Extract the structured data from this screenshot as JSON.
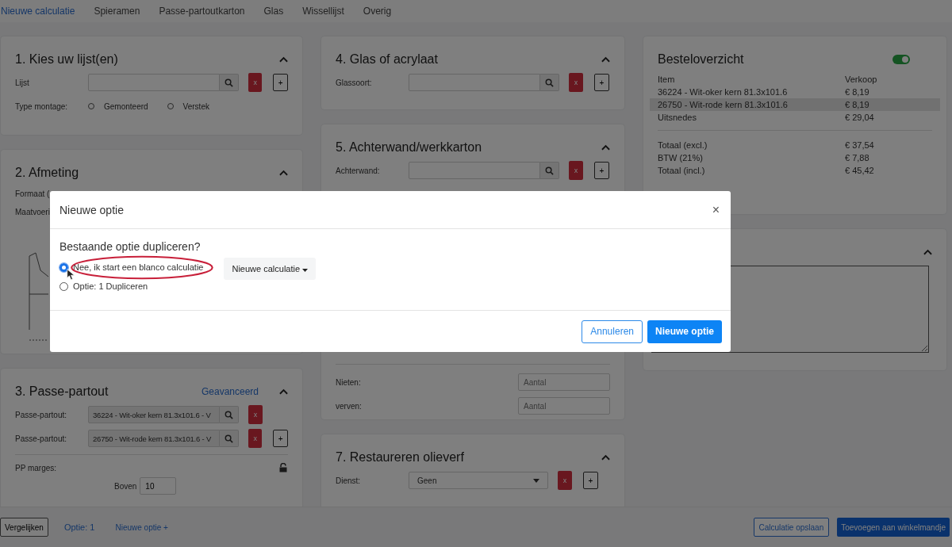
{
  "nav_tabs": [
    {
      "label": "Nieuwe calculatie",
      "selected": true
    },
    {
      "label": "Spieramen",
      "selected": false
    },
    {
      "label": "Passe-partoutkarton",
      "selected": false
    },
    {
      "label": "Glas",
      "selected": false
    },
    {
      "label": "Wissellijst",
      "selected": false
    },
    {
      "label": "Overig",
      "selected": false
    }
  ],
  "section_1": {
    "title": "1. Kies uw lijst(en)",
    "field_label": "Lijst",
    "remove_label": "x",
    "add_label": "+",
    "montage_label": "Type montage:",
    "montage_options": [
      {
        "label": "Gemonteerd",
        "selected": false
      },
      {
        "label": "Verstek",
        "selected": false
      }
    ]
  },
  "section_2": {
    "title": "2. Afmeting",
    "labels": [
      "Formaat (",
      "Maatvoeri"
    ]
  },
  "section_3": {
    "title": "3. Passe-partout",
    "advanced_link": "Geavanceerd",
    "rows": [
      {
        "label": "Passe-partout:",
        "value": "36224 - Wit-oker kern 81.3x101.6 - V",
        "remove_label": "x"
      },
      {
        "label": "Passe-partout:",
        "value": "26750 - Wit-rode kern 81.3x101.6 - V",
        "remove_label": "x",
        "add_label": "+"
      }
    ],
    "margins_label": "PP marges:",
    "top_label": "Boven",
    "top_value": "10"
  },
  "section_4": {
    "title": "4. Glas of acrylaat",
    "field_label": "Glassoort:",
    "remove_label": "x",
    "add_label": "+"
  },
  "section_5": {
    "title": "5. Achterwand/werkkarton",
    "field_label": "Achterwand:",
    "remove_label": "x",
    "add_label": "+"
  },
  "section_6_fields": [
    {
      "label": "Nieten:",
      "placeholder": "Aantal"
    },
    {
      "label": "verven:",
      "placeholder": "Aantal"
    }
  ],
  "section_7": {
    "title": "7. Restaureren olieverf",
    "field_label": "Dienst:",
    "value": "Geen",
    "remove_label": "x",
    "add_label": "+"
  },
  "order_summary": {
    "title": "Besteloverzicht",
    "toggle_on": true,
    "columns": [
      "Item",
      "Verkoop"
    ],
    "items": [
      {
        "name": "36224 - Wit-oker kern 81.3x101.6",
        "price": "€ 8,19",
        "highlighted": false
      },
      {
        "name": "26750 - Wit-rode kern 81.3x101.6",
        "price": "€ 8,19",
        "highlighted": true
      },
      {
        "name": "Uitsnedes",
        "price": "€ 29,04",
        "highlighted": false
      }
    ],
    "totals": [
      {
        "name": "Totaal (excl.)",
        "price": "€ 37,54"
      },
      {
        "name": "BTW (21%)",
        "price": "€ 7,88"
      },
      {
        "name": "Totaal (incl.)",
        "price": "€ 45,42"
      }
    ]
  },
  "bottom_bar": {
    "compare": "Vergelijken",
    "option_link": "Optie: 1",
    "new_option_link": "Nieuwe optie +",
    "save": "Calculatie opslaan",
    "add_to_cart": "Toevoegen aan winkelmandje"
  },
  "modal": {
    "title": "Nieuwe optie",
    "close": "×",
    "question": "Bestaande optie dupliceren?",
    "options": [
      {
        "label": "Nee, ik start een blanco calculatie",
        "selected": true
      },
      {
        "label": "Optie: 1 Dupliceren",
        "selected": false
      }
    ],
    "dropdown": "Nieuwe calculatie",
    "cancel": "Annuleren",
    "confirm": "Nieuwe optie"
  }
}
